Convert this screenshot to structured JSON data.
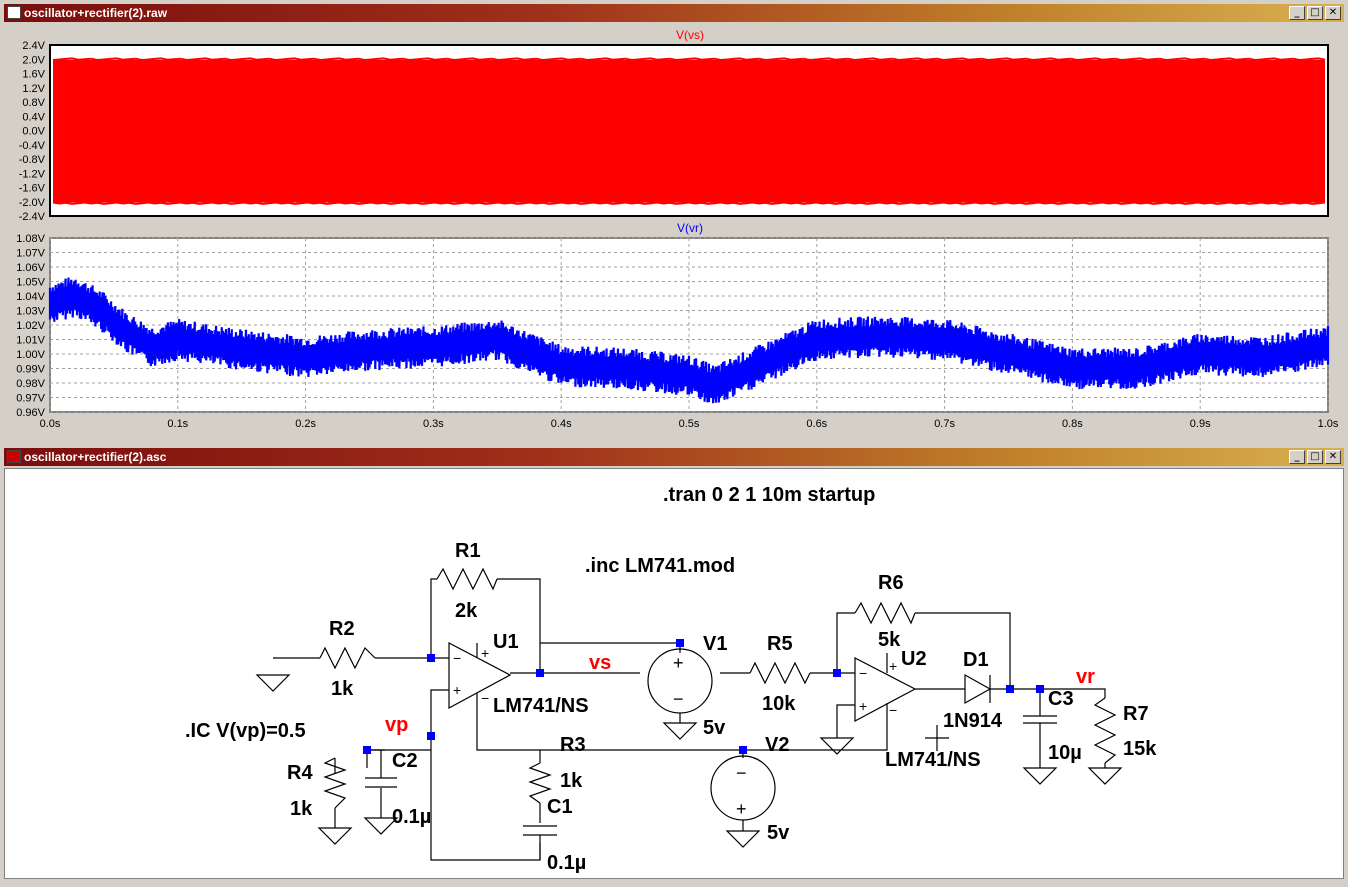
{
  "waveform_window": {
    "title": "oscillator+rectifier(2).raw",
    "buttons": {
      "minimize": "_",
      "restore": "□",
      "close": "✕"
    }
  },
  "schematic_window": {
    "title": "oscillator+rectifier(2).asc",
    "buttons": {
      "minimize": "_",
      "restore": "□",
      "close": "✕"
    }
  },
  "colors": {
    "vs_trace": "#ff0000",
    "vr_trace": "#0000ff",
    "grid": "#a0a0a0",
    "title_start": "#7a0d0d",
    "title_end": "#d8b050"
  },
  "chart_data": [
    {
      "type": "line",
      "title": "V(vs)",
      "ylim": [
        -2.4,
        2.4
      ],
      "yticks": [
        "2.4V",
        "2.0V",
        "1.6V",
        "1.2V",
        "0.8V",
        "0.4V",
        "0.0V",
        "-0.4V",
        "-0.8V",
        "-1.2V",
        "-1.6V",
        "-2.0V",
        "-2.4V"
      ],
      "xlim": [
        0,
        1.0
      ],
      "grid": false,
      "series": [
        {
          "name": "V(vs)",
          "envelope_high": 1.98,
          "envelope_low": -2.02
        }
      ]
    },
    {
      "type": "line",
      "title": "V(vr)",
      "ylim": [
        0.96,
        1.08
      ],
      "yticks": [
        "1.08V",
        "1.07V",
        "1.06V",
        "1.05V",
        "1.04V",
        "1.03V",
        "1.02V",
        "1.01V",
        "1.00V",
        "0.99V",
        "0.98V",
        "0.97V",
        "0.96V"
      ],
      "xlim": [
        0,
        1.0
      ],
      "xticks": [
        "0.0s",
        "0.1s",
        "0.2s",
        "0.3s",
        "0.4s",
        "0.5s",
        "0.6s",
        "0.7s",
        "0.8s",
        "0.9s",
        "1.0s"
      ],
      "grid": true,
      "series": [
        {
          "name": "V(vr)",
          "x": [
            0.0,
            0.02,
            0.04,
            0.06,
            0.08,
            0.1,
            0.15,
            0.2,
            0.25,
            0.3,
            0.35,
            0.4,
            0.45,
            0.5,
            0.52,
            0.55,
            0.6,
            0.65,
            0.7,
            0.75,
            0.8,
            0.85,
            0.9,
            0.95,
            1.0
          ],
          "y_mid": [
            1.035,
            1.04,
            1.03,
            1.015,
            1.005,
            1.01,
            1.003,
            0.998,
            1.003,
            1.005,
            1.01,
            0.992,
            0.99,
            0.985,
            0.978,
            0.99,
            1.01,
            1.012,
            1.01,
            1.0,
            0.99,
            0.99,
            1.0,
            0.998,
            1.005
          ],
          "y_band": 0.012
        }
      ]
    }
  ],
  "schematic": {
    "directives": {
      "tran": ".tran 0 2 1 10m startup",
      "inc": ".inc LM741.mod",
      "ic": ".IC V(vp)=0.5"
    },
    "nets": {
      "vs": "vs",
      "vp": "vp",
      "vr": "vr"
    },
    "components": {
      "R1": {
        "name": "R1",
        "value": "2k"
      },
      "R2": {
        "name": "R2",
        "value": "1k"
      },
      "R3": {
        "name": "R3",
        "value": "1k"
      },
      "R4": {
        "name": "R4",
        "value": "1k"
      },
      "R5": {
        "name": "R5",
        "value": "10k"
      },
      "R6": {
        "name": "R6",
        "value": "5k"
      },
      "R7": {
        "name": "R7",
        "value": "15k"
      },
      "C1": {
        "name": "C1",
        "value": "0.1µ"
      },
      "C2": {
        "name": "C2",
        "value": "0.1µ"
      },
      "C3": {
        "name": "C3",
        "value": "10µ"
      },
      "U1": {
        "name": "U1",
        "value": "LM741/NS"
      },
      "U2": {
        "name": "U2",
        "value": "LM741/NS"
      },
      "V1": {
        "name": "V1",
        "value": "5v"
      },
      "V2": {
        "name": "V2",
        "value": "5v"
      },
      "D1": {
        "name": "D1",
        "value": "1N914"
      }
    }
  }
}
